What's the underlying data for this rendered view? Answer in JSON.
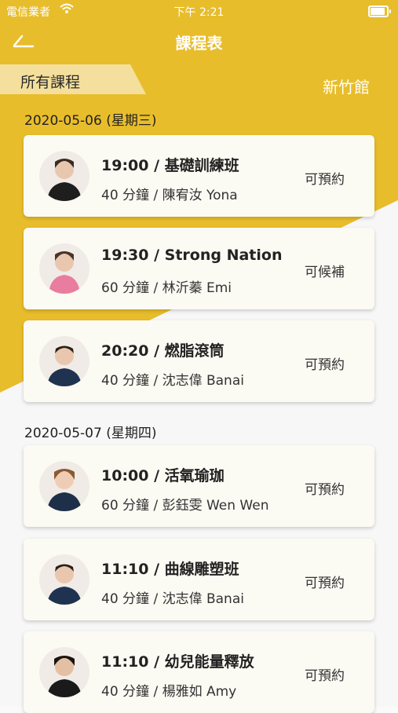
{
  "status_bar": {
    "carrier": "電信業者",
    "time": "下午 2:21"
  },
  "header": {
    "title": "課程表"
  },
  "filter": {
    "label": "所有課程",
    "branch": "新竹館"
  },
  "days": [
    {
      "date": "2020-05-06 (星期三)",
      "classes": [
        {
          "title": "19:00 / 基礎訓練班",
          "detail": "40 分鐘 / 陳宥汝 Yona",
          "status": "可預約"
        },
        {
          "title": "19:30 / Strong Nation",
          "detail": "60 分鐘 / 林沂蓁 Emi",
          "status": "可候補"
        },
        {
          "title": "20:20 / 燃脂滾筒",
          "detail": "40 分鐘 / 沈志偉 Banai",
          "status": "可預約"
        }
      ]
    },
    {
      "date": "2020-05-07 (星期四)",
      "classes": [
        {
          "title": "10:00 / 活氧瑜珈",
          "detail": "60 分鐘 / 彭鈺雯 Wen Wen",
          "status": "可預約"
        },
        {
          "title": "11:10 / 曲線雕塑班",
          "detail": "40 分鐘 / 沈志偉 Banai",
          "status": "可預約"
        },
        {
          "title": "11:10 / 幼兒能量釋放",
          "detail": "40 分鐘 / 楊雅如 Amy",
          "status": "可預約"
        }
      ]
    }
  ],
  "colors": {
    "brand_yellow": "#e8bd2b",
    "tab_yellow": "#f4df9c",
    "card_bg": "#fbfaf3"
  }
}
